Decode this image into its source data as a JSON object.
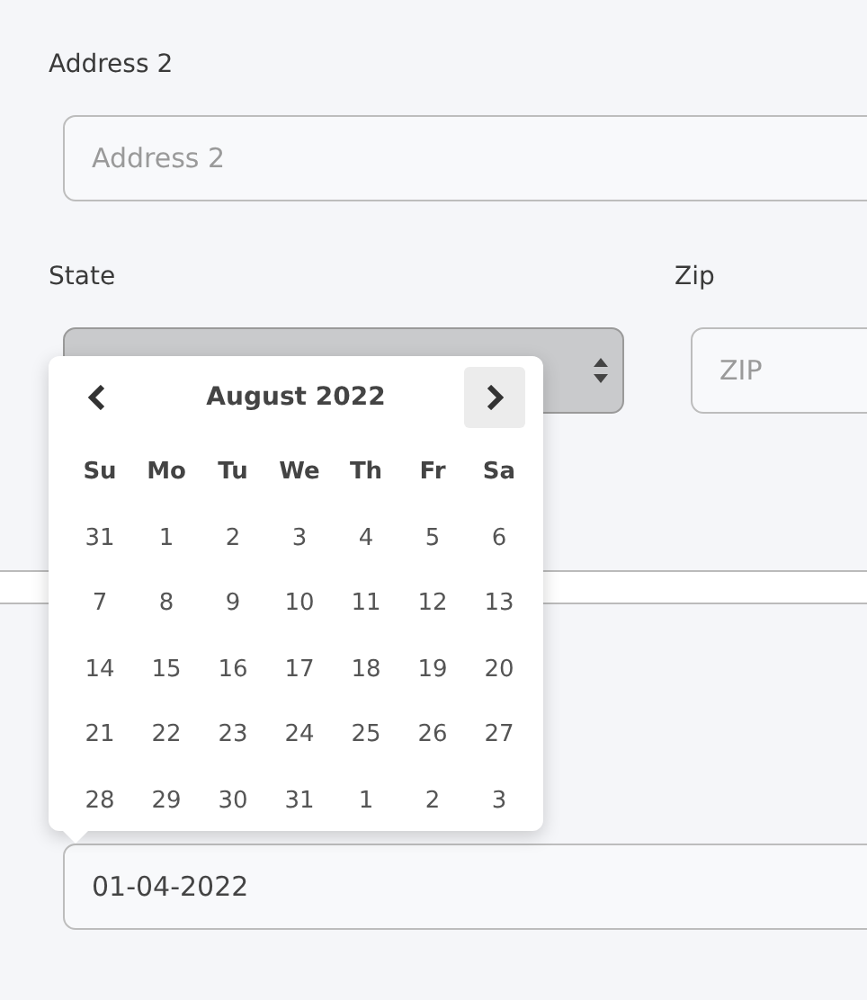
{
  "address2": {
    "label": "Address 2",
    "placeholder": "Address 2"
  },
  "state": {
    "label": "State"
  },
  "zip": {
    "label": "Zip",
    "placeholder": "ZIP"
  },
  "date_field": {
    "value": "01-04-2022"
  },
  "datepicker": {
    "title": "August 2022",
    "next_hovered": true,
    "weekdays": [
      "Su",
      "Mo",
      "Tu",
      "We",
      "Th",
      "Fr",
      "Sa"
    ],
    "weeks": [
      [
        "31",
        "1",
        "2",
        "3",
        "4",
        "5",
        "6"
      ],
      [
        "7",
        "8",
        "9",
        "10",
        "11",
        "12",
        "13"
      ],
      [
        "14",
        "15",
        "16",
        "17",
        "18",
        "19",
        "20"
      ],
      [
        "21",
        "22",
        "23",
        "24",
        "25",
        "26",
        "27"
      ],
      [
        "28",
        "29",
        "30",
        "31",
        "1",
        "2",
        "3"
      ]
    ]
  }
}
